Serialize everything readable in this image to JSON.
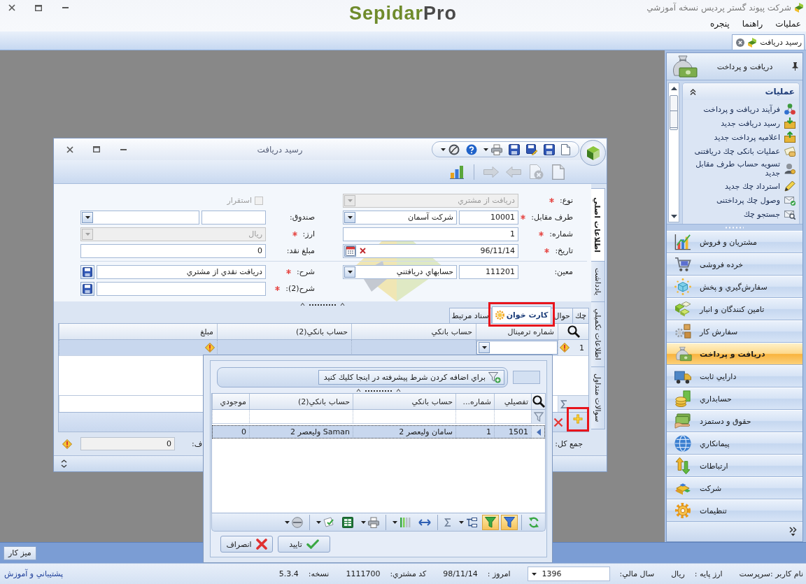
{
  "titlebar": {
    "app_name": "شرکت پیوند گستر پردیس نسخه آموزشي",
    "logo_main": "Sepidar",
    "logo_suffix": "Pro"
  },
  "menu": [
    {
      "label": "عملیات"
    },
    {
      "label": "راهنما"
    },
    {
      "label": "پنجره"
    }
  ],
  "document_tabs": [
    {
      "label": "رسید دریافت",
      "selected": true
    }
  ],
  "dialog": {
    "title": "رسید دریافت",
    "toolbar": [
      {
        "kind": "new",
        "disabled": true
      },
      {
        "kind": "delete",
        "disabled": true
      },
      {
        "kind": "previous",
        "disabled": true
      },
      {
        "kind": "next",
        "disabled": true
      },
      {
        "kind": "report",
        "disabled": false
      }
    ],
    "form": {
      "groups": [
        {
          "rows": [
            {
              "right": {
                "label": "نوع:",
                "required": true,
                "kind": "combo",
                "value": "دریافت از مشتري",
                "disabled": true
              },
              "left": {
                "kind": "checkbox",
                "label": "استقرار",
                "checked": false,
                "disabled": true
              }
            },
            {
              "right": {
                "label": "طرف مقابل:",
                "required": true,
                "kind": "code-combo",
                "code": "10001",
                "value": "شرکت آسمان",
                "disabled": false
              },
              "left": {
                "label": "صندوق:",
                "required": false,
                "kind": "text-combo",
                "disabled": false
              }
            },
            {
              "right": {
                "label": "شماره:",
                "required": true,
                "kind": "text",
                "value": "1",
                "disabled": false
              },
              "left": {
                "label": "ارز:",
                "required": true,
                "kind": "combo",
                "value": "ريال",
                "disabled": true
              }
            },
            {
              "right": {
                "label": "تاریخ:",
                "required": true,
                "kind": "date",
                "value": "96/11/14",
                "disabled": false
              },
              "left": {
                "label": "مبلغ نقد:",
                "required": false,
                "kind": "text",
                "value": "0",
                "disabled": false
              }
            }
          ]
        },
        {
          "rows": [
            {
              "right": {
                "label": "معین:",
                "required": false,
                "kind": "code-combo",
                "code": "111201",
                "value": "حسابهاي دريافتني",
                "disabled": false
              },
              "left": {
                "label": "شرح:",
                "required": true,
                "kind": "text-save",
                "value": "دريافت نقدي از مشتري",
                "disabled": false
              }
            },
            {
              "left": {
                "label": "شرح(2):",
                "required": true,
                "kind": "text-save",
                "disabled": false
              }
            }
          ]
        }
      ]
    },
    "grid": {
      "tabs": [
        {
          "label": "چك",
          "selected": false,
          "highlighted": false
        },
        {
          "label": "حوال",
          "selected": false,
          "highlighted": false
        },
        {
          "label": "کارت خوان",
          "selected": true,
          "highlighted": true
        },
        {
          "label": "سناد مرتبط",
          "selected": false,
          "highlighted": false
        }
      ],
      "columns": [
        "شماره ترمینال",
        "حساب بانکي",
        "حساب بانکي(2)",
        "مبلغ"
      ],
      "rows": [
        {
          "number": "1",
          "selected": true,
          "error": true,
          "editing": true
        }
      ],
      "row_buttons": [
        {
          "kind": "add",
          "highlighted": true
        },
        {
          "kind": "delete",
          "highlighted": false
        }
      ],
      "totals": {
        "label": "جمع کل:",
        "partial_label": "ف:",
        "value": "0",
        "warning": true
      }
    },
    "side_tabs": [
      {
        "label": "اطلاعات اصلي",
        "selected": true
      },
      {
        "label": "يادداشت",
        "selected": false
      },
      {
        "label": "اطلاعات تكميلي",
        "selected": false
      },
      {
        "label": "سوالات متداول",
        "selected": false
      }
    ]
  },
  "lookup_popup": {
    "condition_bar": "براي اضافه كردن شرط پيشرفته در اينجا كليك كنيد",
    "columns": [
      "تفصيلي",
      "شماره...",
      "حساب بانكي",
      "حساب بانكي(2)",
      "موجودي"
    ],
    "rows": [
      {
        "cells": [
          "1501",
          "1",
          "سامان وليعصر 2",
          "Saman وليعصر 2",
          "0"
        ],
        "selected": true
      }
    ],
    "toolbar_groups": [
      {
        "tools": [
          {
            "kind": "refresh",
            "active": false,
            "menu": false
          }
        ]
      },
      {
        "tools": [
          {
            "kind": "filter",
            "active": true,
            "menu": false
          },
          {
            "kind": "auto-filter",
            "active": true,
            "menu": false
          },
          {
            "kind": "group",
            "active": false,
            "menu": true
          },
          {
            "kind": "sum",
            "active": false,
            "menu": false
          }
        ]
      },
      {
        "tools": [
          {
            "kind": "best-fit",
            "active": false,
            "menu": false
          },
          {
            "kind": "columns",
            "active": false,
            "menu": true
          }
        ]
      },
      {
        "tools": [
          {
            "kind": "print",
            "active": false,
            "menu": true
          },
          {
            "kind": "excel",
            "active": false,
            "menu": false
          },
          {
            "kind": "export",
            "active": false,
            "menu": true
          }
        ]
      },
      {
        "tools": [
          {
            "kind": "clear",
            "active": false,
            "menu": true
          }
        ]
      }
    ],
    "buttons": [
      {
        "kind": "ok",
        "label": "تاييد"
      },
      {
        "kind": "cancel",
        "label": "انصراف"
      }
    ]
  },
  "sidebar": {
    "title": "دریافت و پرداخت",
    "group": {
      "title": "عملیات",
      "expanded": true,
      "items": [
        {
          "label": "فرآیند دریافت و پرداخت"
        },
        {
          "label": "رسید دریافت جدید"
        },
        {
          "label": "اعلامیه پرداخت جدید"
        },
        {
          "label": "عملیات بانکی چك دریافتنی"
        },
        {
          "label": "تسویه حساب طرف مقابل جدید"
        },
        {
          "label": "استرداد چك جدید"
        },
        {
          "label": "وصول چك پرداختنی"
        },
        {
          "label": "جستجو چك"
        }
      ]
    },
    "modules": [
      {
        "label": "مشتریان و فروش",
        "selected": false
      },
      {
        "label": "خرده فروشی",
        "selected": false
      },
      {
        "label": "سفارش‌گیري و پخش",
        "selected": false
      },
      {
        "label": "تامین کنندگان و انبار",
        "selected": false
      },
      {
        "label": "سفارش کار",
        "selected": false
      },
      {
        "label": "دریافت و پرداخت",
        "selected": true
      },
      {
        "label": "دارايي ثابت",
        "selected": false
      },
      {
        "label": "حسابداري",
        "selected": false
      },
      {
        "label": "حقوق و دستمزد",
        "selected": false
      },
      {
        "label": "پیمانکاري",
        "selected": false
      },
      {
        "label": "ارتباطات",
        "selected": false
      },
      {
        "label": "شرکت",
        "selected": false
      },
      {
        "label": "تنظیمات",
        "selected": false
      }
    ]
  },
  "bottom_bar": {
    "button": "میز کار"
  },
  "status_bar": {
    "items": [
      {
        "kind": "text",
        "label": "نام کاربر :سرپرست"
      },
      {
        "kind": "text",
        "label": "ارز پایه :",
        "value": "ريال"
      },
      {
        "kind": "dropdown",
        "label": "سال مالي:",
        "value": "1396"
      },
      {
        "kind": "text",
        "label": "امروز :",
        "value": "98/11/14"
      },
      {
        "kind": "text",
        "label": "کد مشتري:",
        "value": "1111700"
      },
      {
        "kind": "text",
        "label": "نسخه:",
        "value": "5.3.4"
      }
    ],
    "link": "پشتيباني و آموزش"
  }
}
